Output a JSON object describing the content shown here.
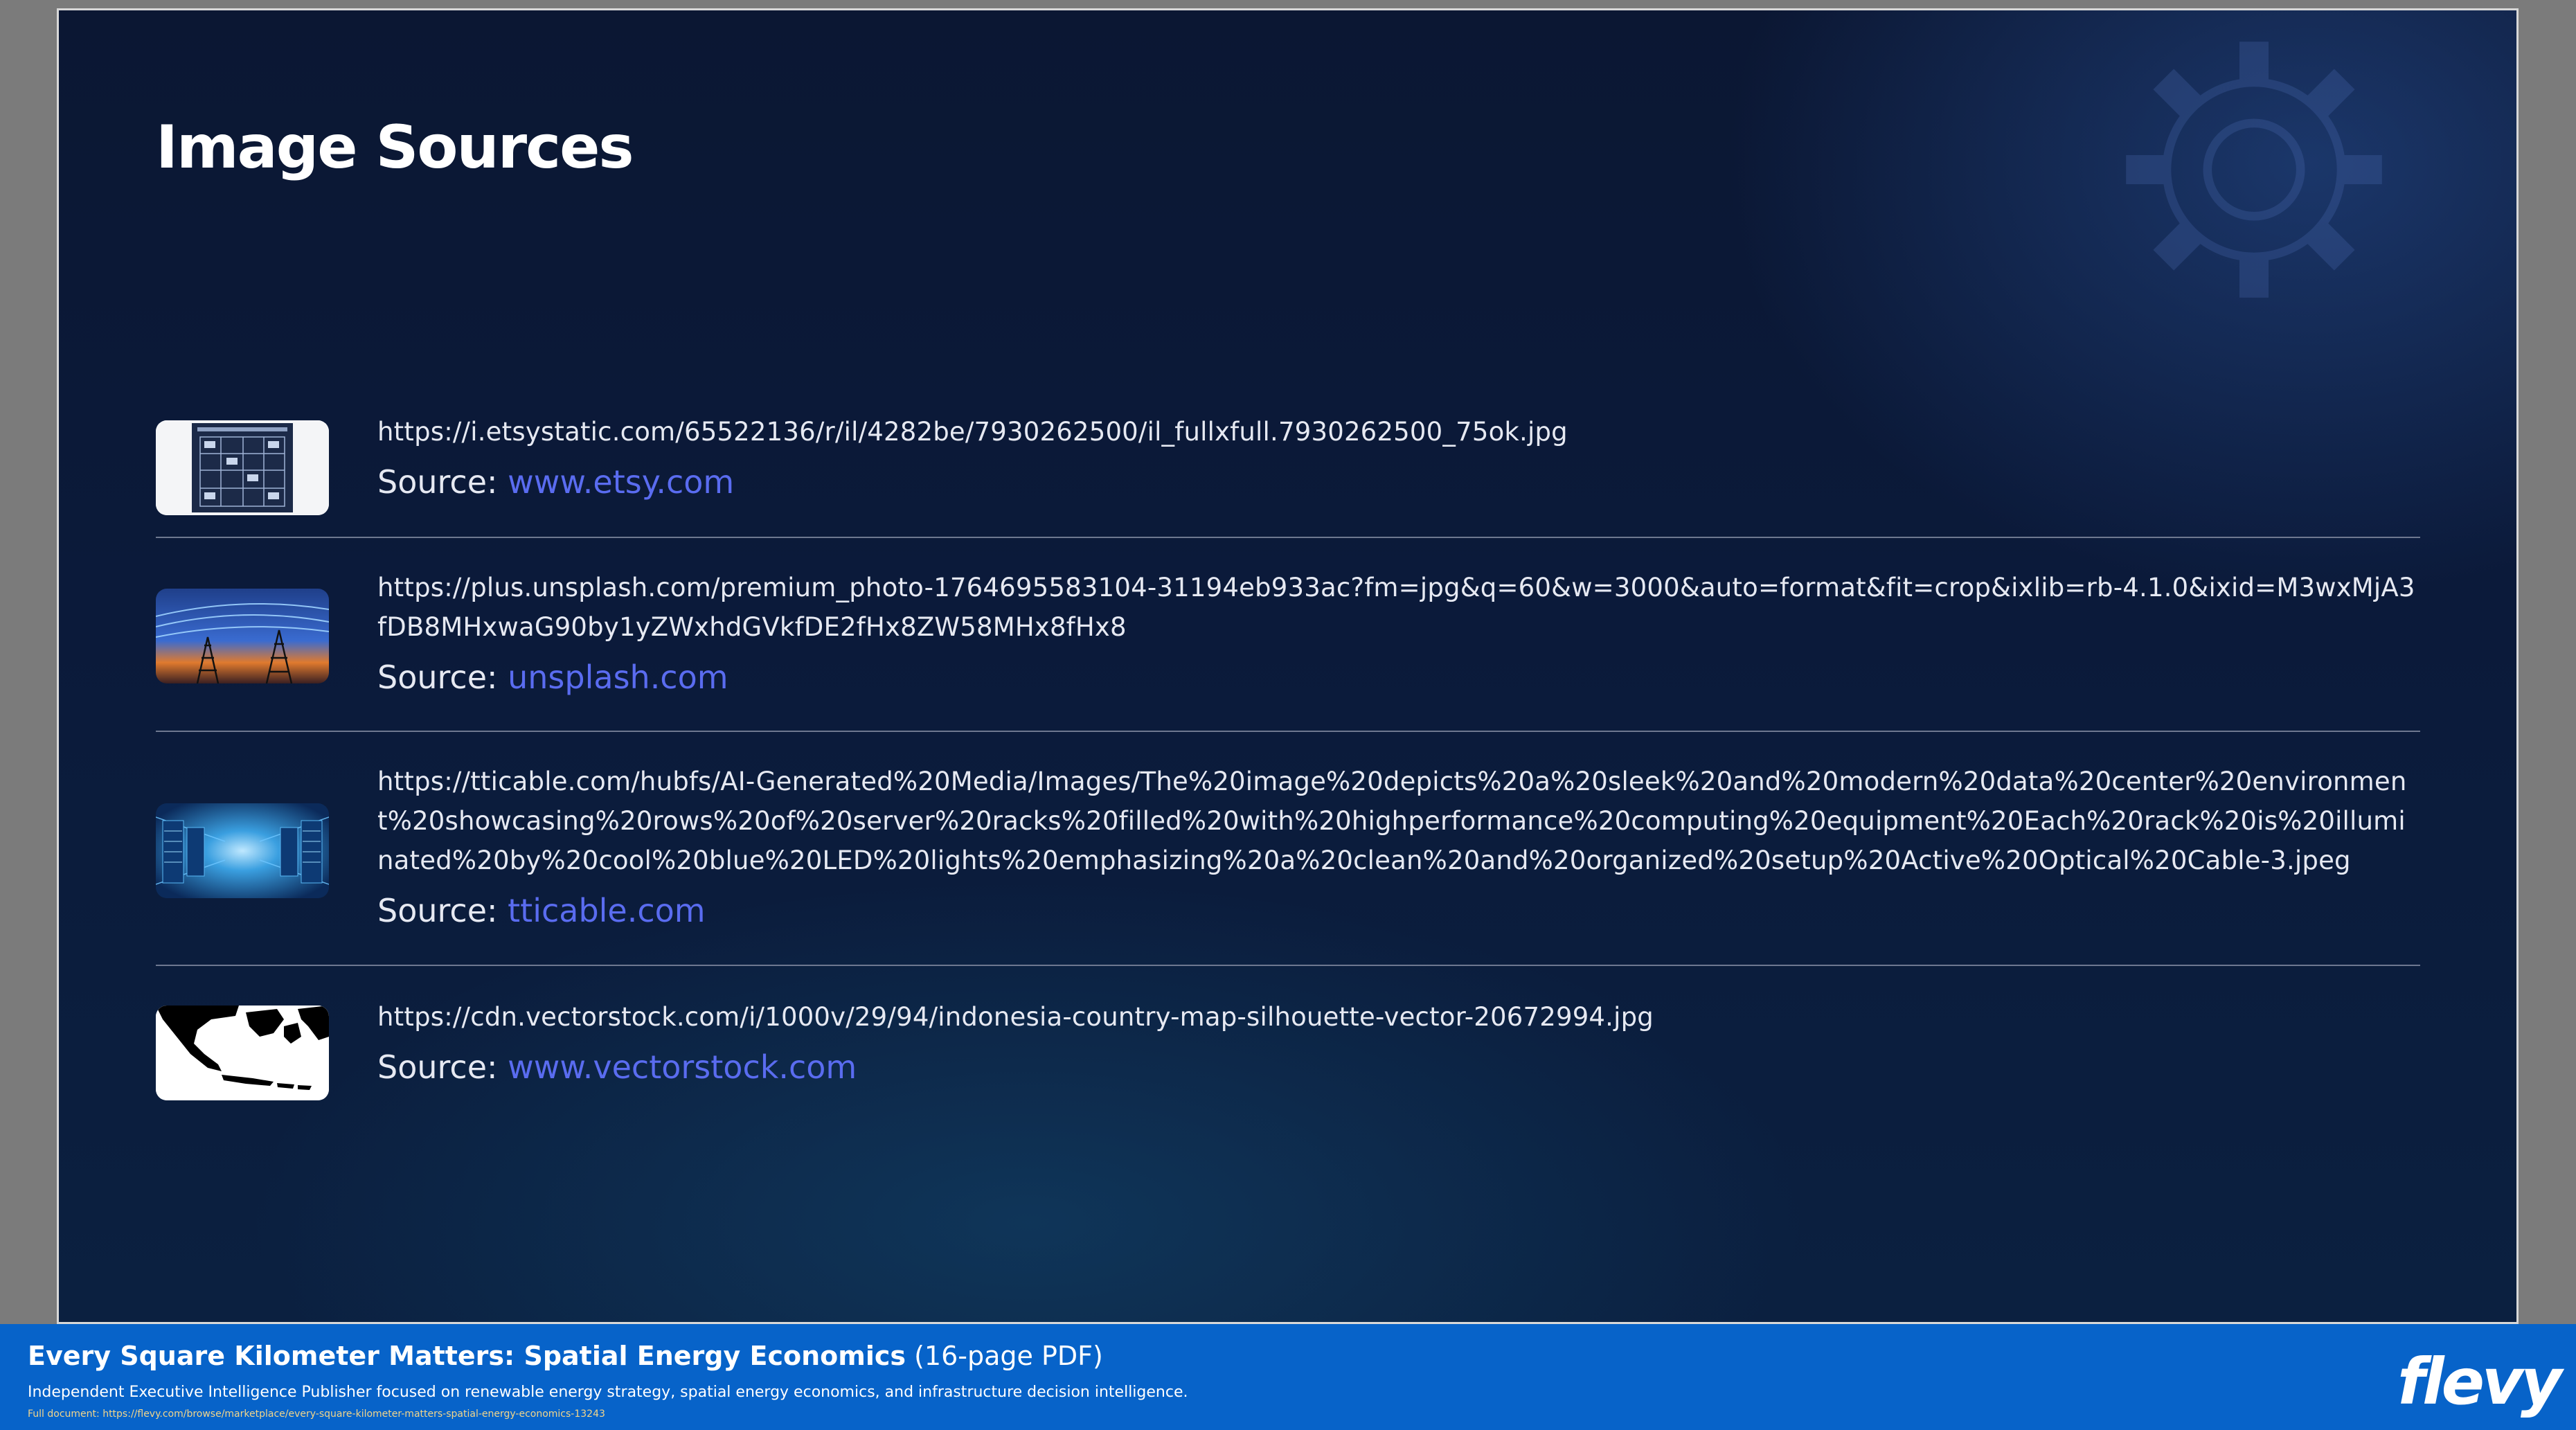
{
  "slide": {
    "title": "Image Sources",
    "source_prefix": "Source: ",
    "items": [
      {
        "url": "https://i.etsystatic.com/65522136/r/il/4282be/7930262500/il_fullxfull.7930262500_75ok.jpg",
        "source": "www.etsy.com",
        "thumb_icon": "blueprint-document-thumbnail"
      },
      {
        "url": "https://plus.unsplash.com/premium_photo-1764695583104-31194eb933ac?fm=jpg&q=60&w=3000&auto=format&fit=crop&ixlib=rb-4.1.0&ixid=M3wxMjA3fDB8MHxwaG90by1yZWxhdGVkfDE2fHx8ZW58MHx8fHx8",
        "source": "unsplash.com",
        "thumb_icon": "power-lines-sunset-thumbnail"
      },
      {
        "url": "https://tticable.com/hubfs/AI-Generated%20Media/Images/The%20image%20depicts%20a%20sleek%20and%20modern%20data%20center%20environment%20showcasing%20rows%20of%20server%20racks%20filled%20with%20highperformance%20computing%20equipment%20Each%20rack%20is%20illuminated%20by%20cool%20blue%20LED%20lights%20emphasizing%20a%20clean%20and%20organized%20setup%20Active%20Optical%20Cable-3.jpeg",
        "source": "tticable.com",
        "thumb_icon": "data-center-thumbnail"
      },
      {
        "url": "https://cdn.vectorstock.com/i/1000v/29/94/indonesia-country-map-silhouette-vector-20672994.jpg",
        "source": "www.vectorstock.com",
        "thumb_icon": "indonesia-map-thumbnail"
      }
    ]
  },
  "footer": {
    "title": "Every Square Kilometer Matters: Spatial Energy Economics",
    "pages": "(16-page PDF)",
    "description": "Independent Executive Intelligence Publisher focused on renewable energy strategy, spatial energy economics, and infrastructure decision intelligence.",
    "link_text": "Full document: https://flevy.com/browse/marketplace/every-square-kilometer-matters-spatial-energy-economics-13243",
    "logo": "flevy"
  },
  "colors": {
    "slide_bg": "#0b1a3a",
    "link": "#5a6cf0",
    "footer_bg": "#0763c9"
  }
}
